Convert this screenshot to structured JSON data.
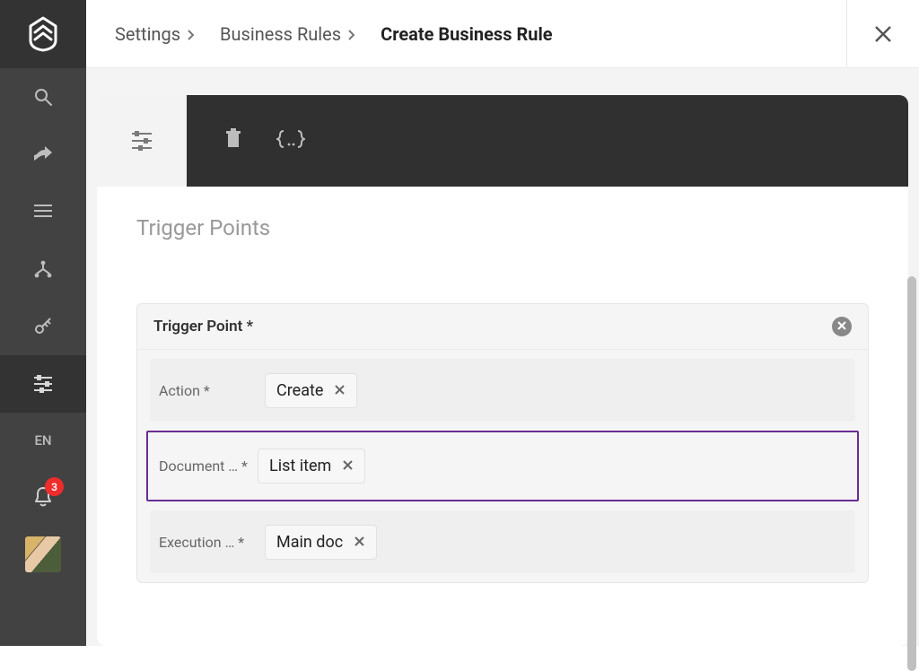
{
  "breadcrumbs": {
    "items": [
      {
        "label": "Settings",
        "current": false
      },
      {
        "label": "Business Rules",
        "current": false
      },
      {
        "label": "Create Business Rule",
        "current": true
      }
    ]
  },
  "sidebar": {
    "language": "EN",
    "notification_count": "3"
  },
  "section": {
    "title": "Trigger Points"
  },
  "trigger_point": {
    "header_label": "Trigger Point  *",
    "fields": {
      "action": {
        "label": "Action *",
        "value": "Create"
      },
      "document": {
        "label": "Document … *",
        "value": "List item"
      },
      "execution": {
        "label": "Execution … *",
        "value": "Main doc"
      }
    }
  }
}
